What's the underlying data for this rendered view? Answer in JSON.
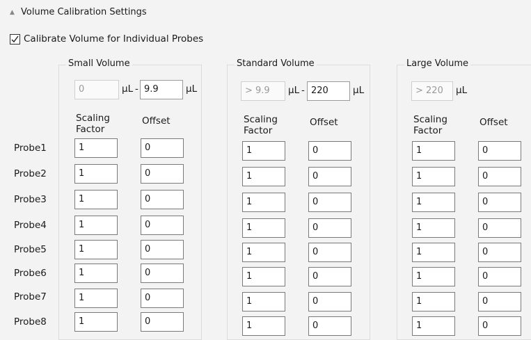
{
  "header": {
    "title": "Volume Calibration Settings"
  },
  "calibrate": {
    "label": "Calibrate Volume for Individual Probes",
    "checked": true
  },
  "groups": [
    {
      "title": "Small Volume",
      "range_min": "0",
      "unit": "µL",
      "dash": "-",
      "range_max": "9.9",
      "col1": [
        "Scaling",
        "Factor"
      ],
      "col2": "Offset"
    },
    {
      "title": "Standard Volume",
      "range_min": "> 9.9",
      "unit": "µL",
      "dash": "-",
      "range_max": "220",
      "col1": [
        "Scaling",
        "Factor"
      ],
      "col2": "Offset"
    },
    {
      "title": "Large Volume",
      "range_min": "> 220",
      "unit": "µL",
      "col1": [
        "Scaling",
        "Factor"
      ],
      "col2": "Offset"
    }
  ],
  "probes": [
    {
      "label": "Probe1",
      "values": [
        "1",
        "0",
        "1",
        "0",
        "1",
        "0"
      ]
    },
    {
      "label": "Probe2",
      "values": [
        "1",
        "0",
        "1",
        "0",
        "1",
        "0"
      ]
    },
    {
      "label": "Probe3",
      "values": [
        "1",
        "0",
        "1",
        "0",
        "1",
        "0"
      ]
    },
    {
      "label": "Probe4",
      "values": [
        "1",
        "0",
        "1",
        "0",
        "1",
        "0"
      ]
    },
    {
      "label": "Probe5",
      "values": [
        "1",
        "0",
        "1",
        "0",
        "1",
        "0"
      ]
    },
    {
      "label": "Probe6",
      "values": [
        "1",
        "0",
        "1",
        "0",
        "1",
        "0"
      ]
    },
    {
      "label": "Probe7",
      "values": [
        "1",
        "0",
        "1",
        "0",
        "1",
        "0"
      ]
    },
    {
      "label": "Probe8",
      "values": [
        "1",
        "0",
        "1",
        "0",
        "1",
        "0"
      ]
    }
  ]
}
